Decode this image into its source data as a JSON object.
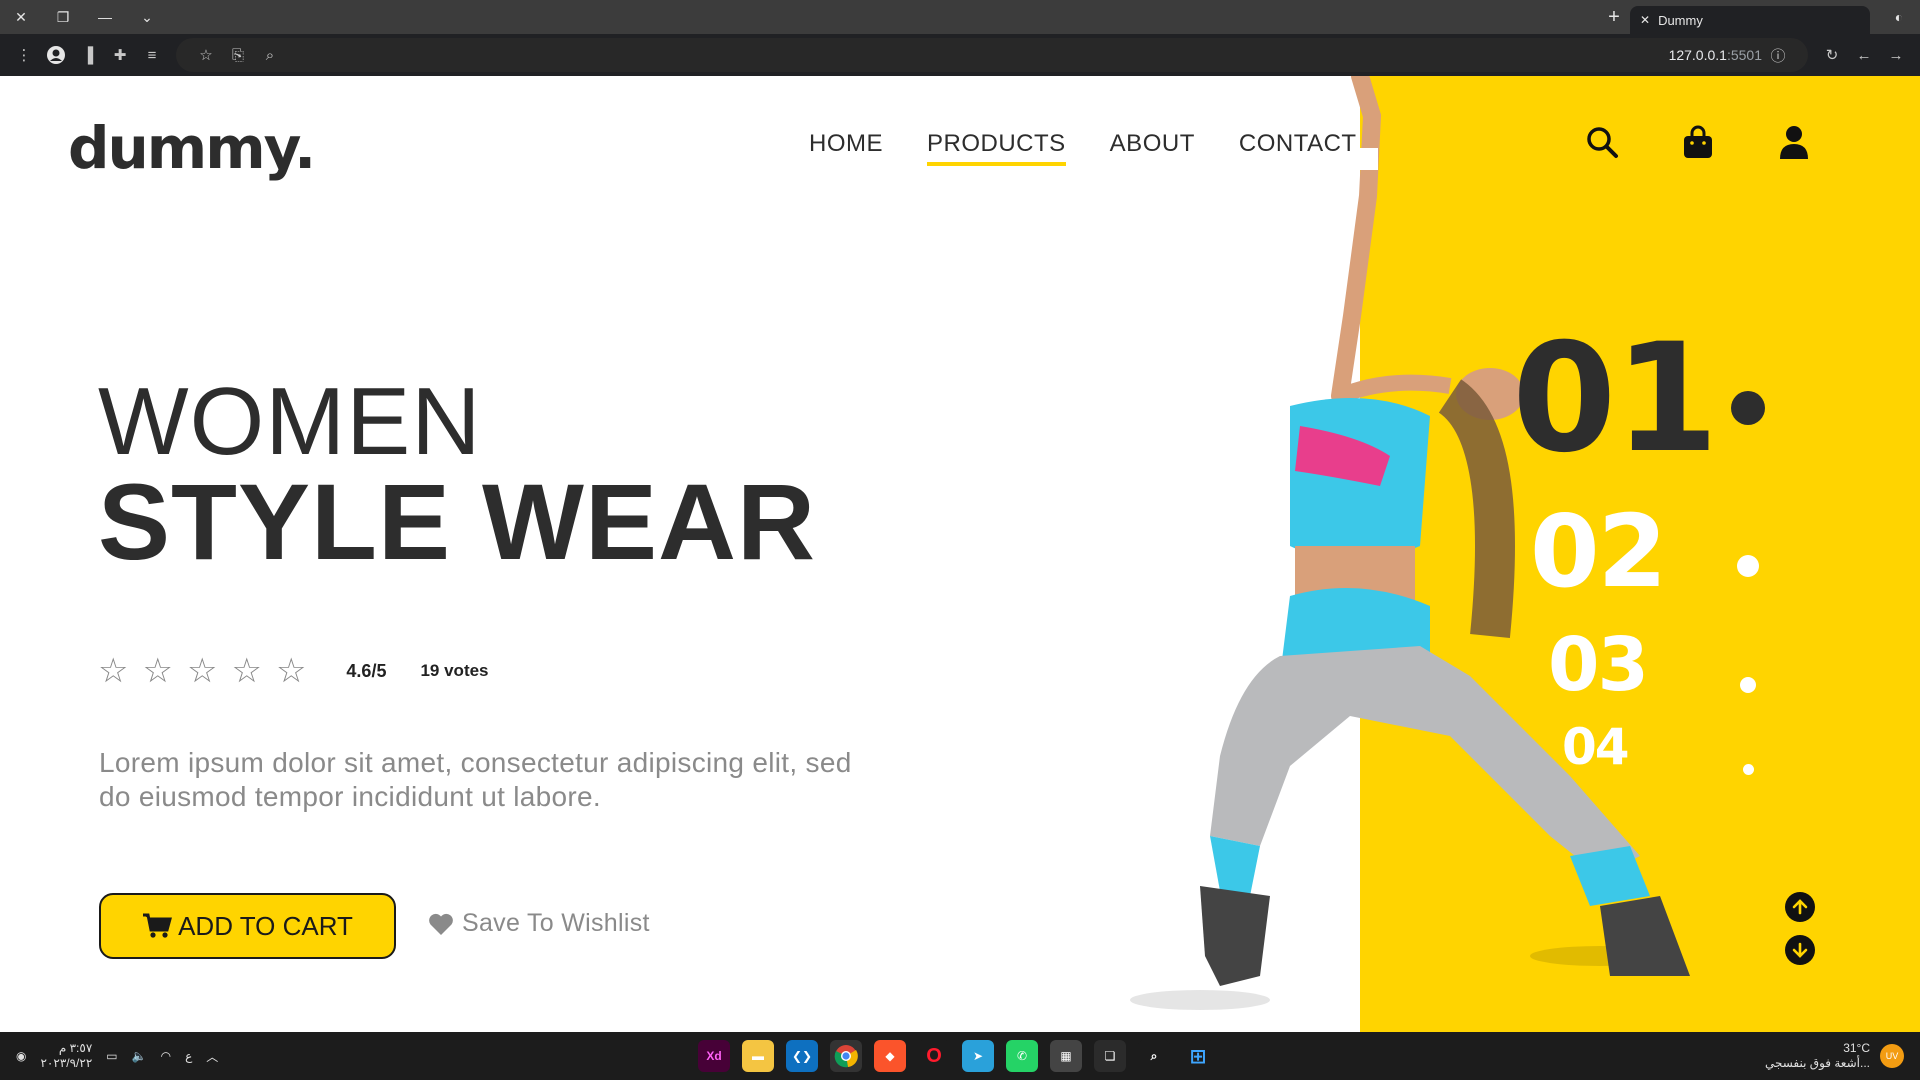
{
  "browser": {
    "tab_title": "Dummy",
    "url_host": "127.0.0.1",
    "url_port": ":5501"
  },
  "site": {
    "logo": "dummy.",
    "nav": [
      "HOME",
      "PRODUCTS",
      "ABOUT",
      "CONTACT"
    ],
    "nav_active": "PRODUCTS",
    "accent_color": "#ffd400",
    "text_color": "#2d2d2d"
  },
  "hero": {
    "title_line1": "WOMEN",
    "title_line2": "STYLE WEAR",
    "rating_score": "4.6/5",
    "rating_votes": "19 votes",
    "description": "Lorem ipsum dolor sit amet, consectetur adipiscing elit, sed do eiusmod tempor incididunt ut labore.",
    "cart_label": "ADD TO CART",
    "wishlist_label": "Save To Wishlist"
  },
  "slider": {
    "numbers": [
      "01",
      "02",
      "03",
      "04"
    ],
    "active": "01"
  },
  "taskbar": {
    "time": "٣:٥٧ م",
    "date": "٢٠٢٣/٩/٢٢",
    "lang": "ع",
    "temperature": "31°C",
    "weather_text": "أشعة فوق بنفسجي...",
    "uv_badge": "UV",
    "apps": [
      "adobe-xd",
      "file-explorer",
      "vscode",
      "chrome",
      "brave",
      "opera",
      "telegram",
      "whatsapp",
      "store",
      "task-view",
      "search",
      "start"
    ]
  }
}
